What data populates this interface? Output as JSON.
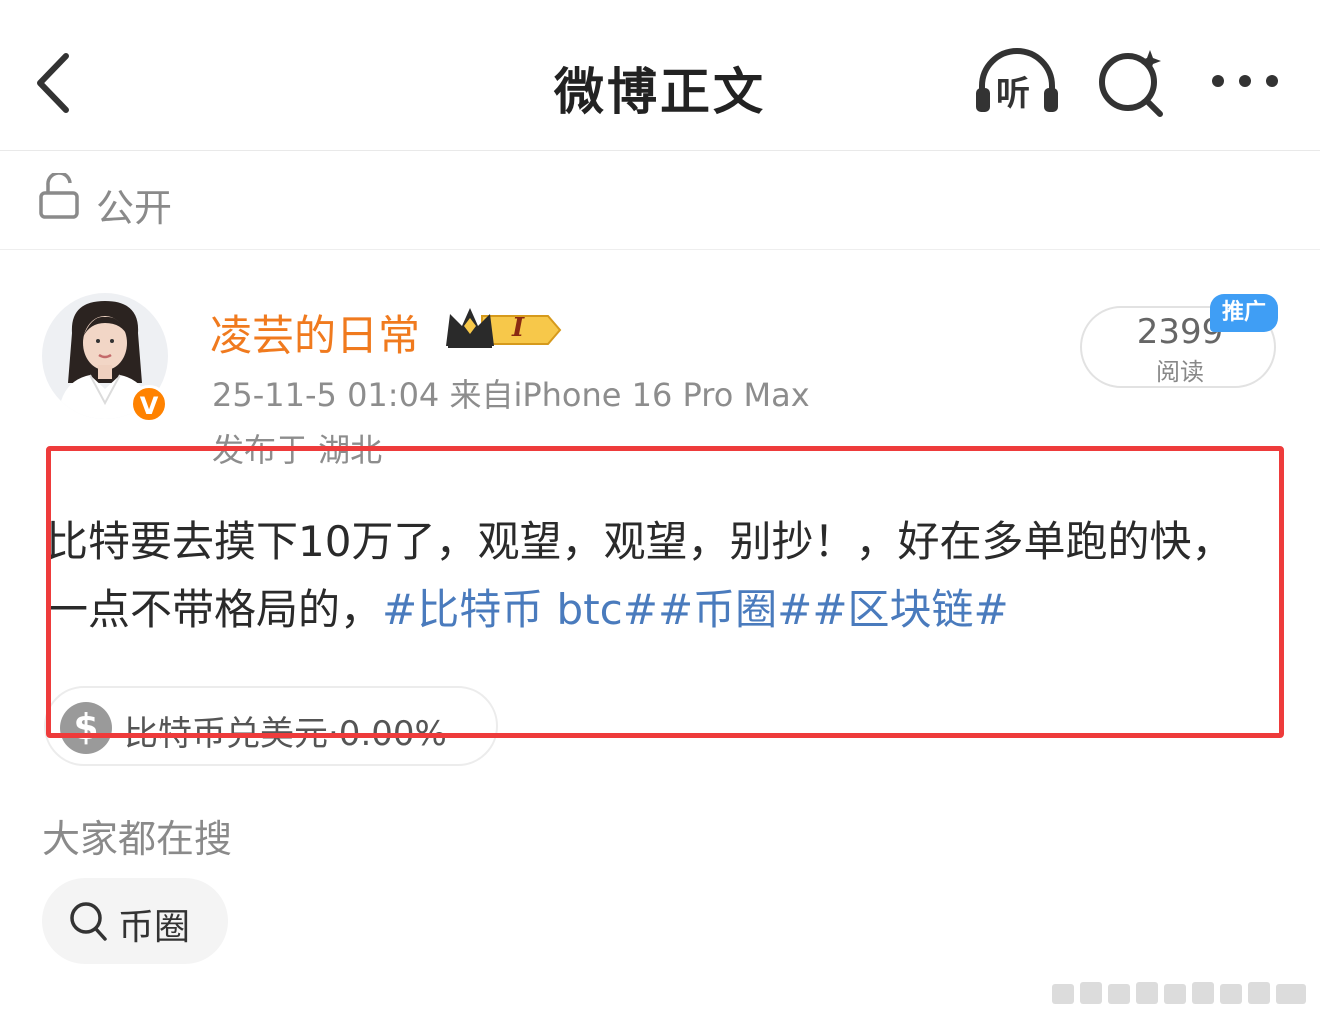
{
  "header": {
    "title": "微博正文",
    "listen_label": "听",
    "back_icon": "chevron-left-icon",
    "search_icon": "search-sparkle-icon",
    "more_icon": "more-horizontal-icon"
  },
  "visibility": {
    "label": "公开",
    "icon": "unlock-icon"
  },
  "author": {
    "name": "凌芸的日常",
    "verified_mark": "V",
    "member_level": "I",
    "name_color": "#f07a1e"
  },
  "post": {
    "meta": "25-11-5 01:04  来自iPhone 16 Pro Max",
    "location": "发布于 湖北",
    "read_count": "2399",
    "read_label": "阅读",
    "promo_tag": "推广",
    "text": "比特要去摸下10万了，观望，观望，别抄！，好在多单跑的快，一点不带格局的，",
    "topics": "#比特币 btc##币圈##区块链#",
    "topic_color": "#4a7bbd"
  },
  "stock_card": {
    "symbol": "$",
    "label": "比特币兑美元·0.00%"
  },
  "search_section": {
    "title": "大家都在搜",
    "chips": [
      {
        "label": "币圈"
      }
    ]
  },
  "colors": {
    "accent": "#ff8200",
    "highlight": "#ee3b3b",
    "promo": "#3f9ef5"
  }
}
